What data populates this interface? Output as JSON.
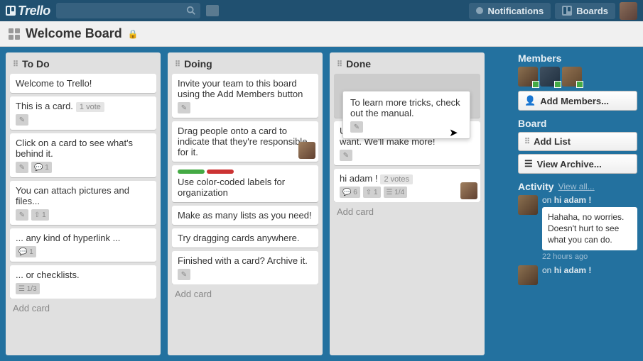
{
  "header": {
    "logo_text": "Trello",
    "notifications_label": "Notifications",
    "boards_label": "Boards"
  },
  "board": {
    "title": "Welcome Board"
  },
  "lists": [
    {
      "title": "To Do",
      "add_card": "Add card",
      "cards": [
        {
          "text": "Welcome to Trello!"
        },
        {
          "text": "This is a card.",
          "vote": "1 vote",
          "icons": [
            "edit"
          ]
        },
        {
          "text": "Click on a card to see what's behind it.",
          "icons": [
            "edit",
            "comment"
          ],
          "comment_count": "1"
        },
        {
          "text": "You can attach pictures and files...",
          "icons": [
            "edit",
            "attach"
          ],
          "attach_count": "1"
        },
        {
          "text": "... any kind of hyperlink ...",
          "icons": [
            "comment"
          ],
          "comment_count": "1"
        },
        {
          "text": "... or checklists.",
          "icons": [
            "checklist"
          ],
          "checklist": "1/3"
        }
      ]
    },
    {
      "title": "Doing",
      "add_card": "Add card",
      "cards": [
        {
          "text": "Invite your team to this board using the Add Members button",
          "icons": [
            "edit"
          ]
        },
        {
          "text": "Drag people onto a card to indicate that they're responsible for it.",
          "avatar": true
        },
        {
          "text": "Use color-coded labels for organization",
          "labels": [
            "#4a4",
            "#c33"
          ]
        },
        {
          "text": "Make as many lists as you need!"
        },
        {
          "text": "Try dragging cards anywhere."
        },
        {
          "text": "Finished with a card? Archive it.",
          "icons": [
            "edit"
          ]
        }
      ]
    },
    {
      "title": "Done",
      "add_card": "Add card",
      "cards": [
        {
          "placeholder": true
        },
        {
          "text": "Use as many boards as you want. We'll make more!",
          "icons": [
            "edit"
          ]
        },
        {
          "text": "hi adam !",
          "vote": "2 votes",
          "icons": [
            "comment",
            "attach",
            "checklist"
          ],
          "comment_count": "6",
          "attach_count": "1",
          "checklist": "1/4",
          "avatar": true
        }
      ]
    }
  ],
  "tooltip": {
    "text": "To learn more tricks, check out the manual."
  },
  "sidebar": {
    "members_title": "Members",
    "add_members_label": "Add Members...",
    "board_title": "Board",
    "add_list_label": "Add List",
    "view_archive_label": "View Archive...",
    "activity_title": "Activity",
    "view_all_label": "View all...",
    "activity": [
      {
        "ref_prefix": "on ",
        "ref": "hi adam !",
        "comment": "Hahaha, no worries. Doesn't hurt to see what you can do.",
        "time": "22 hours ago"
      },
      {
        "ref_prefix": "on ",
        "ref": "hi adam !"
      }
    ]
  }
}
